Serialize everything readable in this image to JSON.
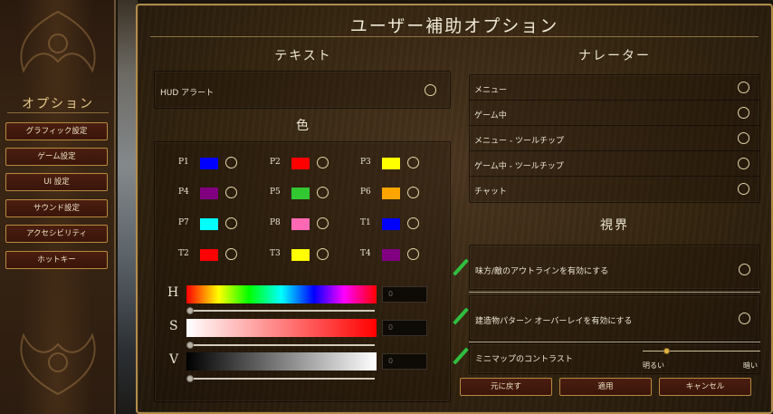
{
  "left_menu": {
    "title": "オプション",
    "items": [
      {
        "label": "グラフィック設定"
      },
      {
        "label": "ゲーム設定"
      },
      {
        "label": "UI 設定"
      },
      {
        "label": "サウンド設定"
      },
      {
        "label": "アクセシビリティ"
      },
      {
        "label": "ホットキー"
      }
    ]
  },
  "dialog": {
    "title": "ユーザー補助オプション"
  },
  "text_section": {
    "heading": "テキスト",
    "hud_alert": {
      "label": "HUD アラート"
    }
  },
  "color_section": {
    "heading": "色",
    "players": [
      {
        "label": "P1",
        "color": "#0000ff"
      },
      {
        "label": "P2",
        "color": "#ff0000"
      },
      {
        "label": "P3",
        "color": "#ffff00"
      },
      {
        "label": "P4",
        "color": "#800080"
      },
      {
        "label": "P5",
        "color": "#32c832"
      },
      {
        "label": "P6",
        "color": "#ffa500"
      },
      {
        "label": "P7",
        "color": "#00ffff"
      },
      {
        "label": "P8",
        "color": "#ff69b4"
      },
      {
        "label": "T1",
        "color": "#0000ff"
      },
      {
        "label": "T2",
        "color": "#ff0000"
      },
      {
        "label": "T3",
        "color": "#ffff00"
      },
      {
        "label": "T4",
        "color": "#800080"
      }
    ],
    "sliders": {
      "h": {
        "label": "H",
        "value": "0",
        "level": 0
      },
      "s": {
        "label": "S",
        "value": "0",
        "level": 0
      },
      "v": {
        "label": "V",
        "value": "0",
        "level": 0
      }
    }
  },
  "narrator_section": {
    "heading": "ナレーター",
    "items": [
      {
        "label": "メニュー"
      },
      {
        "label": "ゲーム中"
      },
      {
        "label": "メニュー - ツールチップ"
      },
      {
        "label": "ゲーム中 - ツールチップ"
      },
      {
        "label": "チャット"
      }
    ]
  },
  "vision_section": {
    "heading": "視界",
    "outline": {
      "label": "味方/敵のアウトラインを有効にする"
    },
    "building_pattern": {
      "label": "建造物パターン オーバーレイを有効にする"
    },
    "minimap_contrast": {
      "label": "ミニマップのコントラスト",
      "min_label": "明るい",
      "max_label": "暗い",
      "level": 0.2
    }
  },
  "buttons": {
    "reset": "元に戻す",
    "apply": "適用",
    "cancel": "キャンセル"
  }
}
